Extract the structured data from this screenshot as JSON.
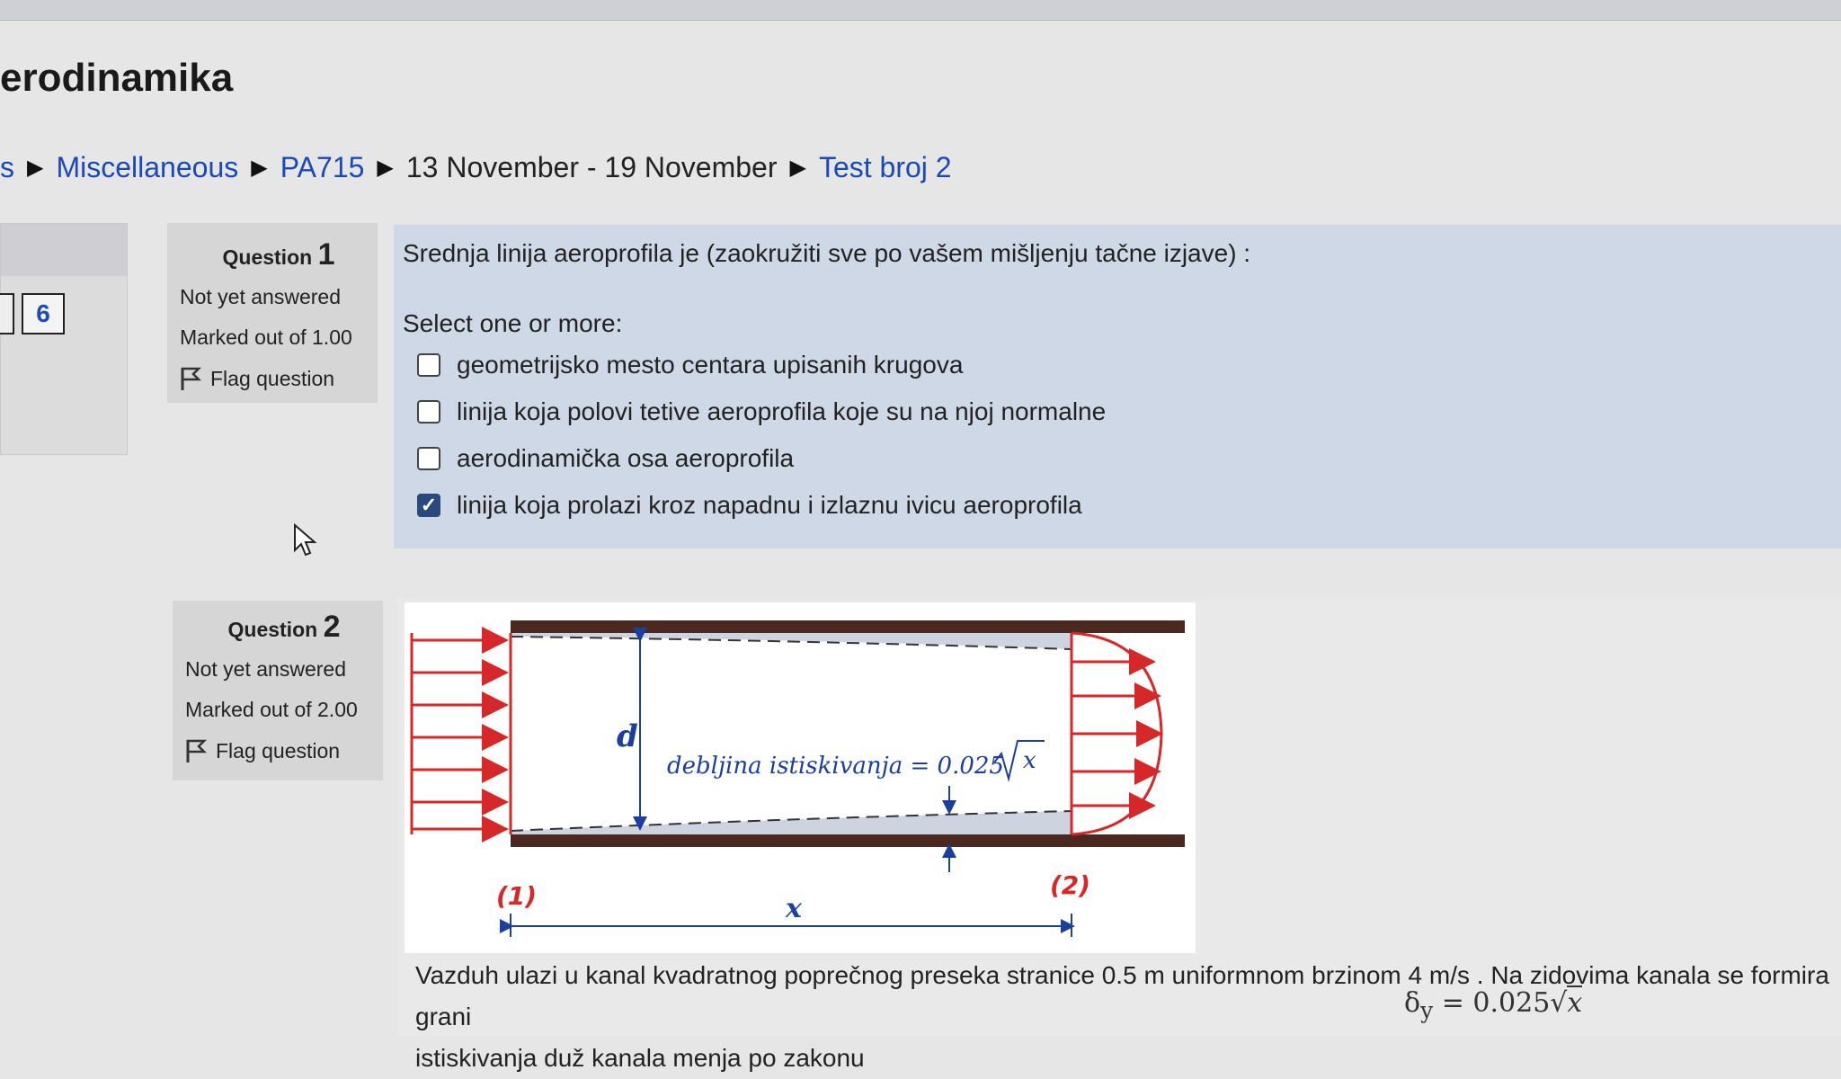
{
  "page": {
    "title": "erodinamika"
  },
  "breadcrumb": {
    "items": [
      {
        "label": "s",
        "link": true
      },
      {
        "label": "Miscellaneous",
        "link": true
      },
      {
        "label": "PA715",
        "link": true
      },
      {
        "label": "13 November - 19 November",
        "link": false
      },
      {
        "label": "Test broj 2",
        "link": true
      }
    ]
  },
  "quiz_nav": {
    "current_button": "6"
  },
  "questions": [
    {
      "label": "Question",
      "number": "1",
      "status": "Not yet answered",
      "marks": "Marked out of 1.00",
      "flag_label": "Flag question",
      "text": "Srednja linija aeroprofila je (zaokružiti sve po vašem mišljenju tačne izjave) :",
      "prompt": "Select one or more:",
      "options": [
        {
          "label": "geometrijsko mesto centara upisanih krugova",
          "checked": false
        },
        {
          "label": "linija koja polovi tetive aeroprofila koje su na njoj normalne",
          "checked": false
        },
        {
          "label": "aerodinamička osa aeroprofila",
          "checked": false
        },
        {
          "label": "linija koja prolazi kroz napadnu i izlaznu ivicu aeroprofila",
          "checked": true
        }
      ]
    },
    {
      "label": "Question",
      "number": "2",
      "status": "Not yet answered",
      "marks": "Marked out of 2.00",
      "flag_label": "Flag question",
      "diagram": {
        "d_label": "d",
        "annotation_text": "debljina istiskivanja = 0.025",
        "sqrt_var": "x",
        "section1_label": "(1)",
        "section2_label": "(2)",
        "x_label": "x"
      },
      "body_line1": "Vazduh ulazi u kanal kvadratnog poprečnog preseka stranice 0.5 m uniformnom brzinom 4 m/s . Na zidovima kanala se formira grani",
      "body_line2": "istiskivanja duž kanala menja po zakonu",
      "formula_lhs": "δ",
      "formula_sub": "y",
      "formula_rhs": "= 0.025",
      "formula_var": "x"
    }
  ],
  "colors": {
    "link": "#1a49b8",
    "arrow": "#d62828",
    "annotation": "#1c3f9e",
    "wall": "#4a2a20",
    "checkbox_checked": "#2a4a7d"
  }
}
